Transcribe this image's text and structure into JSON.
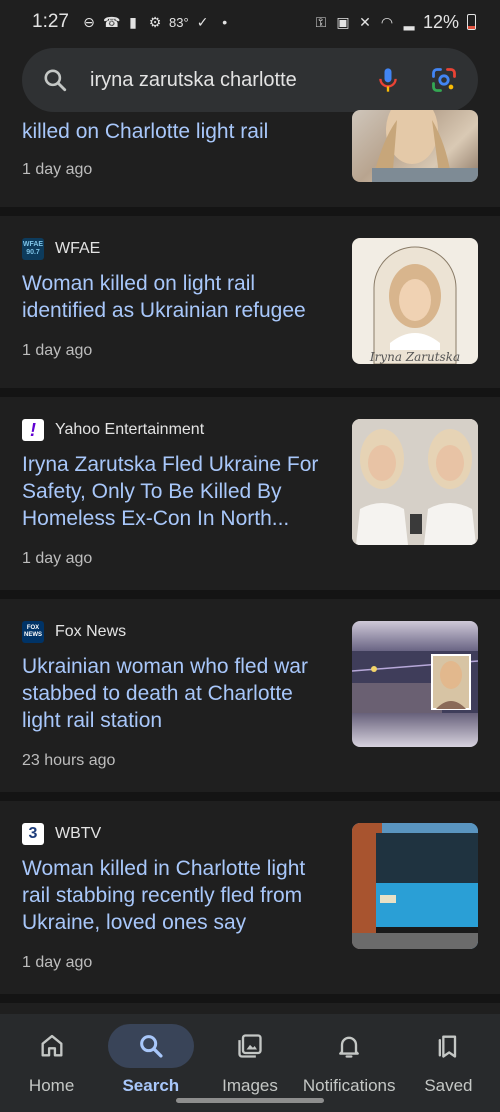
{
  "status_bar": {
    "time": "1:27",
    "temperature": "83°",
    "battery": "12%"
  },
  "search": {
    "query": "iryna zarutska charlotte"
  },
  "results": [
    {
      "headline": "killed on Charlotte light rail",
      "time": "1 day ago"
    },
    {
      "source": "WFAE",
      "favicon_text": "WFAE 90.7",
      "headline": "Woman killed on light rail identified as Ukrainian refugee",
      "time": "1 day ago",
      "thumb_caption": "Iryna Zarutska"
    },
    {
      "source": "Yahoo Entertainment",
      "favicon_text": "!",
      "headline": "Iryna Zarutska Fled Ukraine For Safety, Only To Be Killed By Homeless Ex-Con In North...",
      "time": "1 day ago"
    },
    {
      "source": "Fox News",
      "favicon_text": "FOX NEWS",
      "headline": "Ukrainian woman who fled war stabbed to death at Charlotte light rail station",
      "time": "23 hours ago"
    },
    {
      "source": "WBTV",
      "favicon_text": "3",
      "headline": "Woman killed in Charlotte light rail stabbing recently fled from Ukraine, loved ones say",
      "time": "1 day ago"
    }
  ],
  "nav": [
    {
      "label": "Home",
      "icon": "home-icon",
      "active": false
    },
    {
      "label": "Search",
      "icon": "search-icon",
      "active": true
    },
    {
      "label": "Images",
      "icon": "images-icon",
      "active": false
    },
    {
      "label": "Notifications",
      "icon": "bell-icon",
      "active": false
    },
    {
      "label": "Saved",
      "icon": "bookmarks-icon",
      "active": false
    }
  ],
  "colors": {
    "link": "#a8c7fa",
    "background": "#1f1f1f",
    "search_bar": "#2f3133",
    "nav_active": "#394458"
  }
}
